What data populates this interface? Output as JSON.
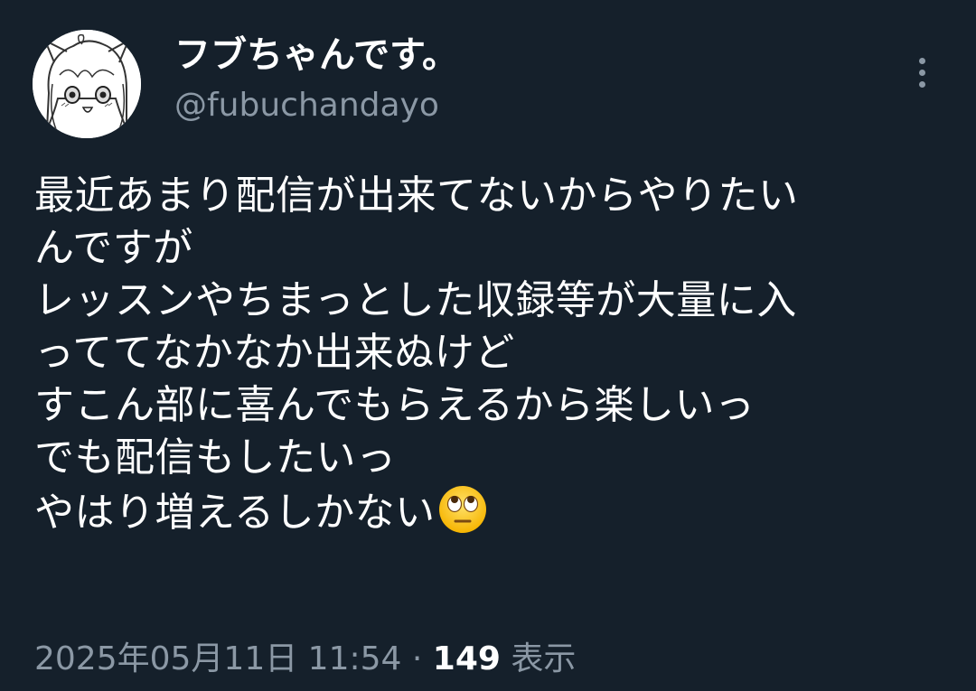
{
  "author": {
    "display_name": "フブちゃんです。",
    "handle": "@fubuchandayo",
    "avatar_icon": "anime-avatar-icon"
  },
  "more_icon": "more-vertical-icon",
  "tweet": {
    "lines": [
      "最近あまり配信が出来てないからやりたい",
      "んですが",
      "レッスンやちまっとした収録等が大量に入",
      "っててなかなか出来ぬけど",
      "すこん部に喜んでもらえるから楽しいっ",
      "でも配信もしたいっ",
      "やはり増えるしかない"
    ],
    "emoji": "face-with-rolling-eyes-emoji"
  },
  "meta": {
    "date_time": "2025年05月11日 11:54",
    "separator": "·",
    "views_count": "149",
    "views_label": "表示"
  },
  "colors": {
    "background": "#15202b",
    "primary_text": "#ffffff",
    "secondary_text": "#8b98a5"
  }
}
